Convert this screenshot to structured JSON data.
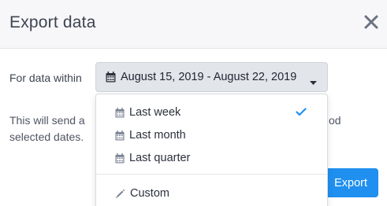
{
  "modal": {
    "title": "Export data",
    "close_icon": "close-icon"
  },
  "range": {
    "label": "For data within",
    "value": "August 15, 2019 - August 22, 2019",
    "icon": "calendar-icon",
    "caret_icon": "caret-down-icon"
  },
  "description": {
    "line1_start": "This will send a",
    "line1_end": "od",
    "line2": "selected dates."
  },
  "dropdown": {
    "items": [
      {
        "label": "Last week",
        "icon": "calendar-icon",
        "selected": true
      },
      {
        "label": "Last month",
        "icon": "calendar-icon",
        "selected": false
      },
      {
        "label": "Last quarter",
        "icon": "calendar-icon",
        "selected": false
      }
    ],
    "custom": {
      "label": "Custom",
      "icon": "pencil-icon"
    }
  },
  "footer": {
    "export_label": "Export"
  },
  "colors": {
    "header_bg": "#f7f7f9",
    "button_bg": "#e2e5ea",
    "primary": "#1f8ff0",
    "check": "#1f8ff0"
  }
}
